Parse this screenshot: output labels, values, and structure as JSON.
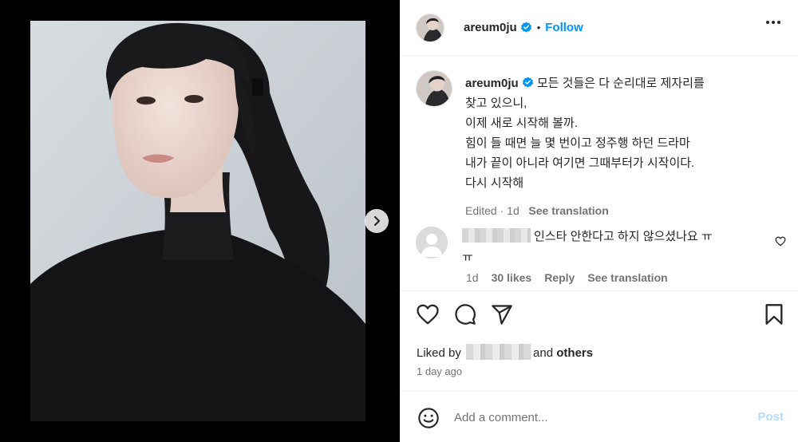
{
  "post": {
    "username": "areum0ju",
    "follow_label": "Follow",
    "caption_lines": "모든 것들은 다 순리대로 제자리를\n찾고 있으니,\n이제 새로 시작해 볼까.\n힘이 들 때면 늘 몇 번이고 정주행 하던 드라마\n내가 끝이 아니라 여기면 그때부터가 시작이다.\n다시 시작해",
    "edited_label": "Edited",
    "edited_time": "1d",
    "see_translation": "See translation"
  },
  "comment": {
    "text": "인스타 안한다고 하지 않으셨나요 ㅠ\nㅠ",
    "time": "1d",
    "likes": "30 likes",
    "reply": "Reply",
    "see_translation": "See translation"
  },
  "likes": {
    "prefix": "Liked by",
    "suffix_and": "and",
    "suffix_others": "others",
    "time": "1 day ago"
  },
  "composer": {
    "placeholder": "Add a comment...",
    "post_label": "Post"
  },
  "carousel": {
    "dots": 4,
    "active": 0
  },
  "colors": {
    "link_blue": "#0095f6",
    "post_disabled": "#b3dbff",
    "verified_blue": "#0095f6"
  }
}
